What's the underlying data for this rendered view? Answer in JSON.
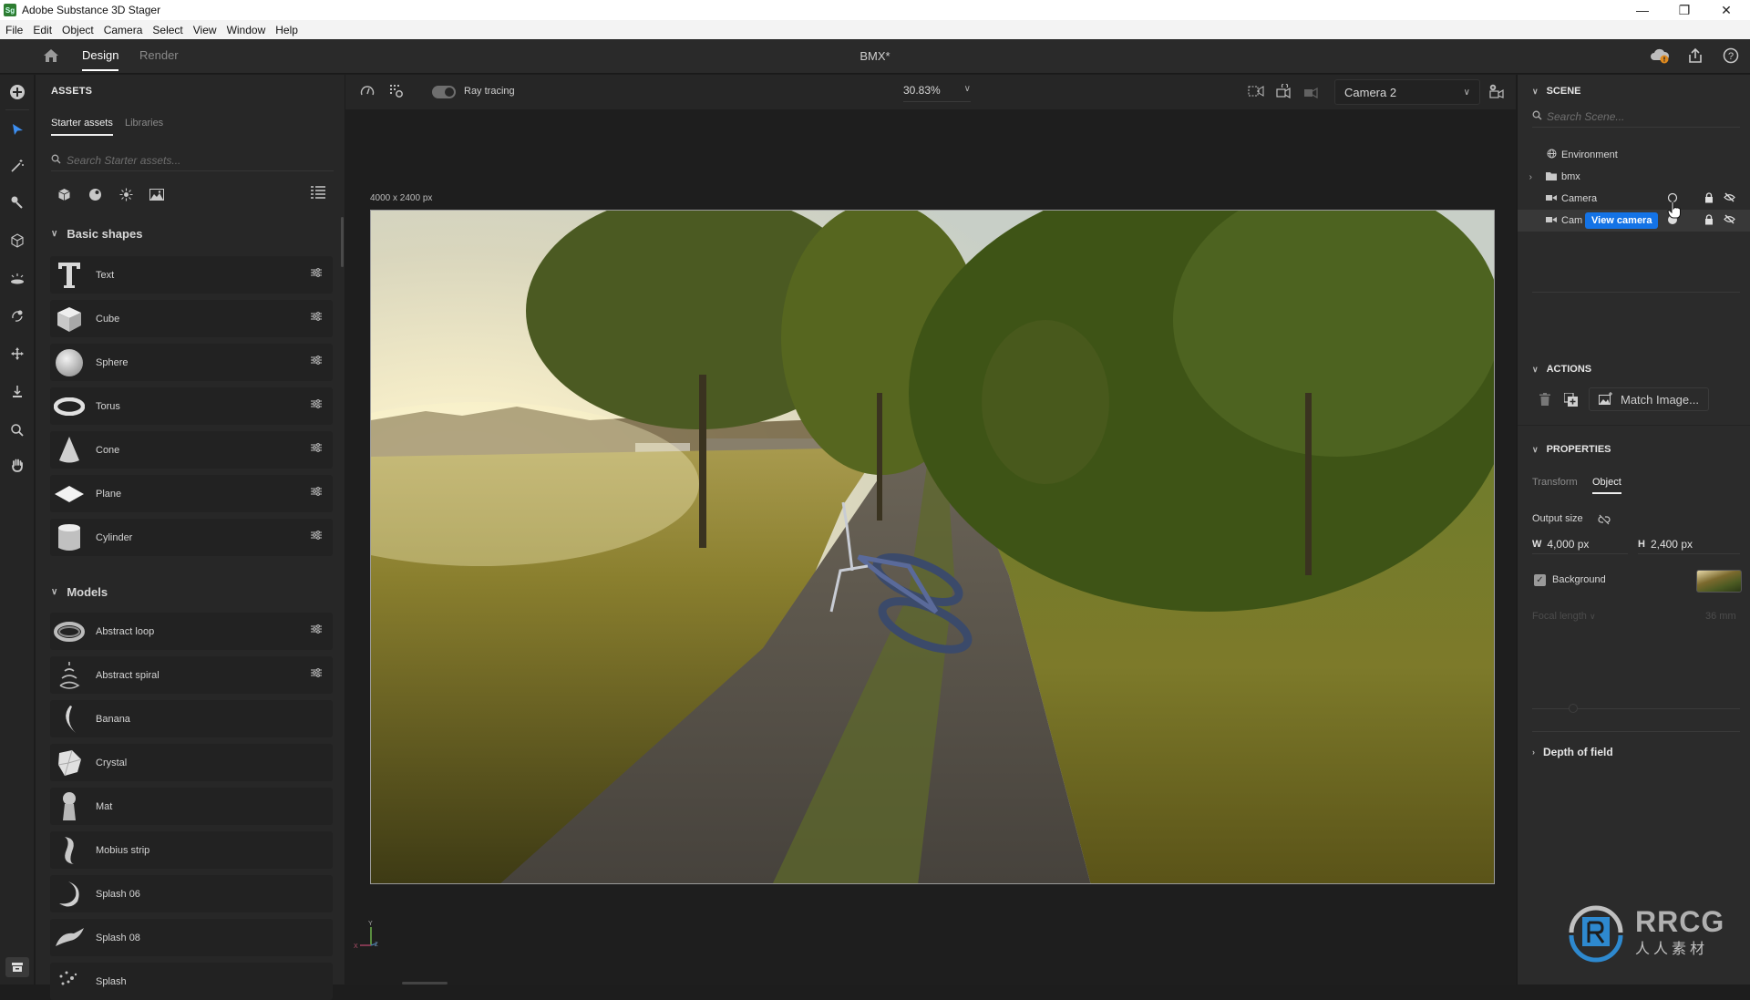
{
  "window": {
    "app_icon_text": "Sg",
    "title": "Adobe Substance 3D Stager",
    "controls": {
      "minimize": "—",
      "restore": "❐",
      "close": "✕"
    }
  },
  "menu": [
    "File",
    "Edit",
    "Object",
    "Camera",
    "Select",
    "View",
    "Window",
    "Help"
  ],
  "appbar": {
    "home_icon": "home-icon",
    "tabs": [
      {
        "label": "Design",
        "active": true
      },
      {
        "label": "Render",
        "active": false
      }
    ],
    "document_title": "BMX*",
    "right_icons": [
      "cloud-sync-warning-icon",
      "share-icon",
      "help-icon"
    ]
  },
  "toolrail": {
    "add_icon": "plus-circle-icon",
    "tools": [
      "select-tool",
      "magic-wand-tool",
      "eyedropper-tool",
      "3d-box-tool",
      "light-tool",
      "orbit-tool",
      "move-tool",
      "drop-to-ground-tool",
      "zoom-tool",
      "hand-tool"
    ],
    "bottom_icon": "archive-icon"
  },
  "assets": {
    "title": "ASSETS",
    "tabs": [
      {
        "label": "Starter assets",
        "active": true
      },
      {
        "label": "Libraries",
        "active": false
      }
    ],
    "search_placeholder": "Search Starter assets...",
    "filters": [
      "models-filter",
      "materials-filter",
      "lights-filter",
      "images-filter"
    ],
    "sections": [
      {
        "title": "Basic shapes",
        "items": [
          {
            "label": "Text",
            "options": true
          },
          {
            "label": "Cube",
            "options": true
          },
          {
            "label": "Sphere",
            "options": true
          },
          {
            "label": "Torus",
            "options": true
          },
          {
            "label": "Cone",
            "options": true
          },
          {
            "label": "Plane",
            "options": true
          },
          {
            "label": "Cylinder",
            "options": true
          }
        ]
      },
      {
        "title": "Models",
        "items": [
          {
            "label": "Abstract loop",
            "options": true
          },
          {
            "label": "Abstract spiral",
            "options": true
          },
          {
            "label": "Banana",
            "options": false
          },
          {
            "label": "Crystal",
            "options": false
          },
          {
            "label": "Mat",
            "options": false
          },
          {
            "label": "Mobius strip",
            "options": false
          },
          {
            "label": "Splash 06",
            "options": false
          },
          {
            "label": "Splash 08",
            "options": false
          },
          {
            "label": "Splash",
            "options": false
          }
        ]
      }
    ]
  },
  "viewport": {
    "ray_tracing_label": "Ray tracing",
    "ray_tracing_on": true,
    "zoom_level": "30.83%",
    "camera": "Camera 2",
    "canvas_dimensions": "4000 x 2400 px",
    "axis_labels": {
      "x": "X",
      "y": "Y",
      "z": "Z"
    }
  },
  "scene": {
    "title": "SCENE",
    "search_placeholder": "Search Scene...",
    "items": [
      {
        "label": "Environment",
        "icon": "globe-icon"
      },
      {
        "label": "bmx",
        "icon": "folder-icon",
        "expandable": true
      },
      {
        "label": "Camera",
        "icon": "camera-icon",
        "locked": true,
        "hidden": true
      },
      {
        "label": "Camera 2",
        "visible_label": "Cam",
        "icon": "camera-icon",
        "locked": true,
        "hidden": true,
        "selected": true
      }
    ],
    "tooltip": "View camera"
  },
  "actions": {
    "title": "ACTIONS",
    "match_image_label": "Match Image..."
  },
  "properties": {
    "title": "PROPERTIES",
    "tabs": [
      {
        "label": "Transform",
        "active": false
      },
      {
        "label": "Object",
        "active": true
      }
    ],
    "output_size_label": "Output size",
    "width_label": "W",
    "width_value": "4,000 px",
    "height_label": "H",
    "height_value": "2,400 px",
    "background_label": "Background",
    "background_checked": true,
    "focal_length_label": "Focal length",
    "focal_length_value": "36 mm",
    "depth_of_field_label": "Depth of field"
  },
  "watermark": {
    "brand": "RRCG",
    "subtitle": "人人素材"
  }
}
